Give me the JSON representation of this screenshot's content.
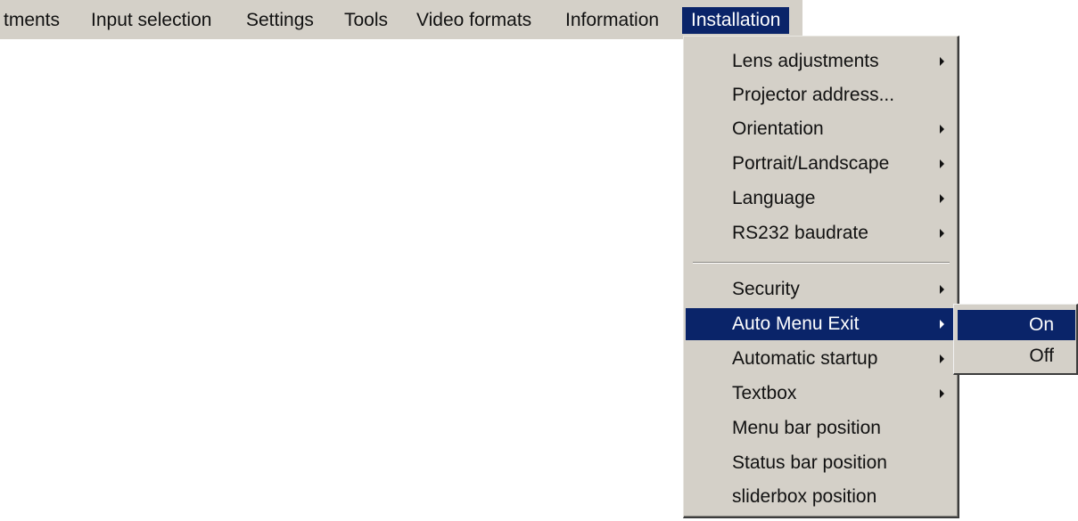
{
  "menubar": {
    "items": [
      "tments",
      "Input selection",
      "Settings",
      "Tools",
      "Video formats",
      "Information",
      "Installation"
    ],
    "active_index": 6
  },
  "installation_menu": {
    "items": [
      {
        "label": "Lens adjustments",
        "has_submenu": true
      },
      {
        "label": "Projector address...",
        "has_submenu": false
      },
      {
        "label": "Orientation",
        "has_submenu": true
      },
      {
        "label": "Portrait/Landscape",
        "has_submenu": true
      },
      {
        "label": "Language",
        "has_submenu": true
      },
      {
        "label": "RS232 baudrate",
        "has_submenu": true
      },
      {
        "label": "Security",
        "has_submenu": true
      },
      {
        "label": "Auto Menu Exit",
        "has_submenu": true,
        "selected": true
      },
      {
        "label": "Automatic startup",
        "has_submenu": true
      },
      {
        "label": "Textbox",
        "has_submenu": true
      },
      {
        "label": "Menu bar position",
        "has_submenu": false
      },
      {
        "label": "Status bar position",
        "has_submenu": false
      },
      {
        "label": "sliderbox position",
        "has_submenu": false
      }
    ]
  },
  "auto_menu_exit_submenu": {
    "items": [
      {
        "label": "On",
        "selected": true
      },
      {
        "label": "Off",
        "selected": false
      }
    ]
  },
  "colors": {
    "menu_bg": "#d4d0c8",
    "highlight": "#0a2469",
    "highlight_text": "#ffffff"
  }
}
